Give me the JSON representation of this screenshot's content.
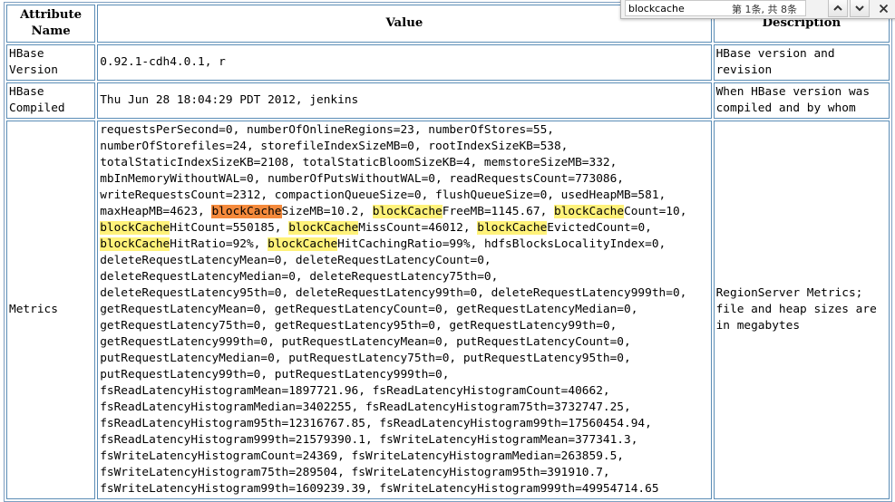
{
  "table": {
    "headers": [
      "Attribute Name",
      "Value",
      "Description"
    ],
    "rows": [
      {
        "name": "HBase Version",
        "value": "0.92.1-cdh4.0.1, r",
        "description": "HBase version and revision"
      },
      {
        "name": "HBase Compiled",
        "value": "Thu Jun 28 18:04:29 PDT 2012, jenkins",
        "description": "When HBase version was compiled and by whom"
      },
      {
        "name": "Metrics",
        "description": "RegionServer Metrics; file and heap sizes are in megabytes"
      }
    ],
    "metrics_lines": [
      [
        {
          "t": "requestsPerSecond=0, numberOfOnlineRegions=23, numberOfStores=55,"
        }
      ],
      [
        {
          "t": "numberOfStorefiles=24, storefileIndexSizeMB=0, rootIndexSizeKB=538,"
        }
      ],
      [
        {
          "t": "totalStaticIndexSizeKB=2108, totalStaticBloomSizeKB=4, memstoreSizeMB=332,"
        }
      ],
      [
        {
          "t": "mbInMemoryWithoutWAL=0, numberOfPutsWithoutWAL=0, readRequestsCount=773086,"
        }
      ],
      [
        {
          "t": "writeRequestsCount=2312, compactionQueueSize=0, flushQueueSize=0, usedHeapMB=581,"
        }
      ],
      [
        {
          "t": "maxHeapMB=4623, "
        },
        {
          "t": "blockCache",
          "h": "active"
        },
        {
          "t": "SizeMB=10.2, "
        },
        {
          "t": "blockCache",
          "h": "match"
        },
        {
          "t": "FreeMB=1145.67, "
        },
        {
          "t": "blockCache",
          "h": "match"
        },
        {
          "t": "Count=10,"
        }
      ],
      [
        {
          "t": "blockCache",
          "h": "match"
        },
        {
          "t": "HitCount=550185, "
        },
        {
          "t": "blockCache",
          "h": "match"
        },
        {
          "t": "MissCount=46012, "
        },
        {
          "t": "blockCache",
          "h": "match"
        },
        {
          "t": "EvictedCount=0,"
        }
      ],
      [
        {
          "t": "blockCache",
          "h": "match"
        },
        {
          "t": "HitRatio=92%, "
        },
        {
          "t": "blockCache",
          "h": "match"
        },
        {
          "t": "HitCachingRatio=99%, hdfsBlocksLocalityIndex=0,"
        }
      ],
      [
        {
          "t": "deleteRequestLatencyMean=0, deleteRequestLatencyCount=0,"
        }
      ],
      [
        {
          "t": "deleteRequestLatencyMedian=0, deleteRequestLatency75th=0,"
        }
      ],
      [
        {
          "t": "deleteRequestLatency95th=0, deleteRequestLatency99th=0, deleteRequestLatency999th=0,"
        }
      ],
      [
        {
          "t": "getRequestLatencyMean=0, getRequestLatencyCount=0, getRequestLatencyMedian=0,"
        }
      ],
      [
        {
          "t": "getRequestLatency75th=0, getRequestLatency95th=0, getRequestLatency99th=0,"
        }
      ],
      [
        {
          "t": "getRequestLatency999th=0, putRequestLatencyMean=0, putRequestLatencyCount=0,"
        }
      ],
      [
        {
          "t": "putRequestLatencyMedian=0, putRequestLatency75th=0, putRequestLatency95th=0,"
        }
      ],
      [
        {
          "t": "putRequestLatency99th=0, putRequestLatency999th=0,"
        }
      ],
      [
        {
          "t": "fsReadLatencyHistogramMean=1897721.96, fsReadLatencyHistogramCount=40662,"
        }
      ],
      [
        {
          "t": "fsReadLatencyHistogramMedian=3402255, fsReadLatencyHistogram75th=3732747.25,"
        }
      ],
      [
        {
          "t": "fsReadLatencyHistogram95th=12316767.85, fsReadLatencyHistogram99th=17560454.94,"
        }
      ],
      [
        {
          "t": "fsReadLatencyHistogram999th=21579390.1, fsWriteLatencyHistogramMean=377341.3,"
        }
      ],
      [
        {
          "t": "fsWriteLatencyHistogramCount=24369, fsWriteLatencyHistogramMedian=263859.5,"
        }
      ],
      [
        {
          "t": "fsWriteLatencyHistogram75th=289504, fsWriteLatencyHistogram95th=391910.7,"
        }
      ],
      [
        {
          "t": "fsWriteLatencyHistogram99th=1609239.39, fsWriteLatencyHistogram999th=49954714.65"
        }
      ]
    ]
  },
  "find_bar": {
    "query": "blockcache",
    "count_text": "第 1条, 共 8条",
    "prev_icon": "chevron-up-icon",
    "next_icon": "chevron-down-icon",
    "close_icon": "close-icon"
  },
  "colors": {
    "border": "#5b8db6",
    "match_highlight": "#fff27a",
    "active_highlight": "#f58a3c"
  }
}
